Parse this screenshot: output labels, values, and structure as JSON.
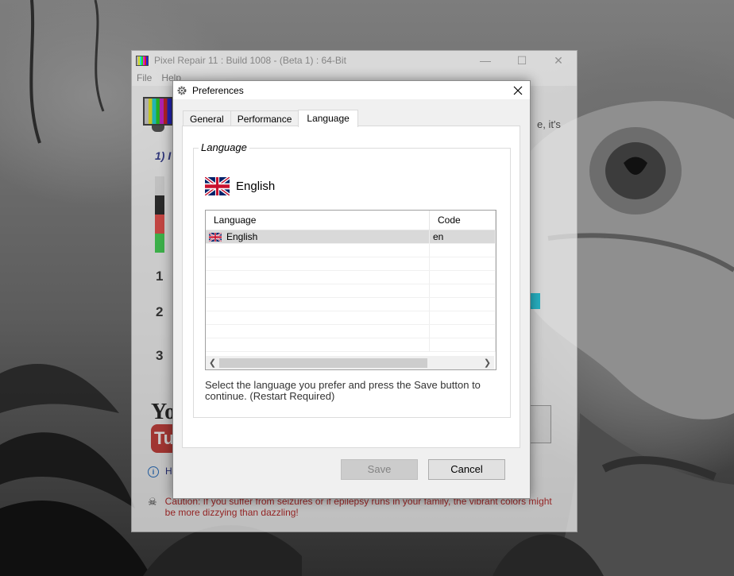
{
  "main_window": {
    "title": "Pixel Repair 11 : Build 1008 - (Beta 1) : 64-Bit",
    "menu": [
      "File",
      "Help"
    ],
    "controls": {
      "minimize": "—",
      "maximize": "☐",
      "close": "✕"
    },
    "step_heading": "1) I",
    "side_text": "e, it's",
    "step_numbers": [
      "1",
      "2",
      "3"
    ],
    "youtube": {
      "you": "Yo",
      "tube": "Tu"
    },
    "info_text": "H",
    "caution_text": "Caution: If you suffer from seizures or if epilepsy runs in your family, the vibrant colors might be more dizzying than dazzling!",
    "swatch_colors": [
      "#e0e0e0",
      "#111111",
      "#e53935",
      "#2ecc40"
    ]
  },
  "dialog": {
    "title": "Preferences",
    "tabs": [
      {
        "label": "General",
        "active": false
      },
      {
        "label": "Performance",
        "active": false
      },
      {
        "label": "Language",
        "active": true
      }
    ],
    "group_title": "Language",
    "current_language": "English",
    "list": {
      "columns": [
        "Language",
        "Code"
      ],
      "rows": [
        {
          "language": "English",
          "code": "en",
          "selected": true
        }
      ]
    },
    "help_text": "Select the language you prefer and press the Save button to continue. (Restart Required)",
    "buttons": {
      "save": "Save",
      "cancel": "Cancel"
    },
    "save_enabled": false
  }
}
